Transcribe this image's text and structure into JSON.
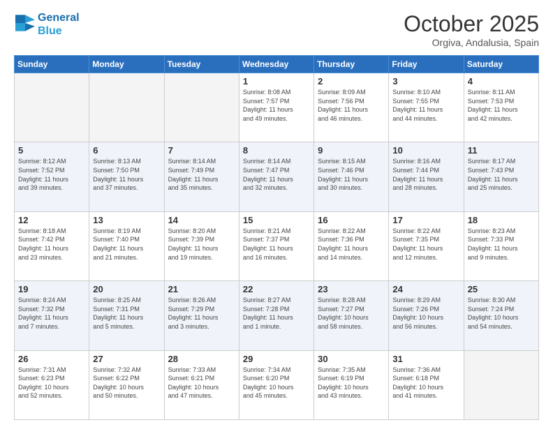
{
  "header": {
    "logo_line1": "General",
    "logo_line2": "Blue",
    "month": "October 2025",
    "location": "Orgiva, Andalusia, Spain"
  },
  "weekdays": [
    "Sunday",
    "Monday",
    "Tuesday",
    "Wednesday",
    "Thursday",
    "Friday",
    "Saturday"
  ],
  "weeks": [
    [
      {
        "day": "",
        "info": ""
      },
      {
        "day": "",
        "info": ""
      },
      {
        "day": "",
        "info": ""
      },
      {
        "day": "1",
        "info": "Sunrise: 8:08 AM\nSunset: 7:57 PM\nDaylight: 11 hours\nand 49 minutes."
      },
      {
        "day": "2",
        "info": "Sunrise: 8:09 AM\nSunset: 7:56 PM\nDaylight: 11 hours\nand 46 minutes."
      },
      {
        "day": "3",
        "info": "Sunrise: 8:10 AM\nSunset: 7:55 PM\nDaylight: 11 hours\nand 44 minutes."
      },
      {
        "day": "4",
        "info": "Sunrise: 8:11 AM\nSunset: 7:53 PM\nDaylight: 11 hours\nand 42 minutes."
      }
    ],
    [
      {
        "day": "5",
        "info": "Sunrise: 8:12 AM\nSunset: 7:52 PM\nDaylight: 11 hours\nand 39 minutes."
      },
      {
        "day": "6",
        "info": "Sunrise: 8:13 AM\nSunset: 7:50 PM\nDaylight: 11 hours\nand 37 minutes."
      },
      {
        "day": "7",
        "info": "Sunrise: 8:14 AM\nSunset: 7:49 PM\nDaylight: 11 hours\nand 35 minutes."
      },
      {
        "day": "8",
        "info": "Sunrise: 8:14 AM\nSunset: 7:47 PM\nDaylight: 11 hours\nand 32 minutes."
      },
      {
        "day": "9",
        "info": "Sunrise: 8:15 AM\nSunset: 7:46 PM\nDaylight: 11 hours\nand 30 minutes."
      },
      {
        "day": "10",
        "info": "Sunrise: 8:16 AM\nSunset: 7:44 PM\nDaylight: 11 hours\nand 28 minutes."
      },
      {
        "day": "11",
        "info": "Sunrise: 8:17 AM\nSunset: 7:43 PM\nDaylight: 11 hours\nand 25 minutes."
      }
    ],
    [
      {
        "day": "12",
        "info": "Sunrise: 8:18 AM\nSunset: 7:42 PM\nDaylight: 11 hours\nand 23 minutes."
      },
      {
        "day": "13",
        "info": "Sunrise: 8:19 AM\nSunset: 7:40 PM\nDaylight: 11 hours\nand 21 minutes."
      },
      {
        "day": "14",
        "info": "Sunrise: 8:20 AM\nSunset: 7:39 PM\nDaylight: 11 hours\nand 19 minutes."
      },
      {
        "day": "15",
        "info": "Sunrise: 8:21 AM\nSunset: 7:37 PM\nDaylight: 11 hours\nand 16 minutes."
      },
      {
        "day": "16",
        "info": "Sunrise: 8:22 AM\nSunset: 7:36 PM\nDaylight: 11 hours\nand 14 minutes."
      },
      {
        "day": "17",
        "info": "Sunrise: 8:22 AM\nSunset: 7:35 PM\nDaylight: 11 hours\nand 12 minutes."
      },
      {
        "day": "18",
        "info": "Sunrise: 8:23 AM\nSunset: 7:33 PM\nDaylight: 11 hours\nand 9 minutes."
      }
    ],
    [
      {
        "day": "19",
        "info": "Sunrise: 8:24 AM\nSunset: 7:32 PM\nDaylight: 11 hours\nand 7 minutes."
      },
      {
        "day": "20",
        "info": "Sunrise: 8:25 AM\nSunset: 7:31 PM\nDaylight: 11 hours\nand 5 minutes."
      },
      {
        "day": "21",
        "info": "Sunrise: 8:26 AM\nSunset: 7:29 PM\nDaylight: 11 hours\nand 3 minutes."
      },
      {
        "day": "22",
        "info": "Sunrise: 8:27 AM\nSunset: 7:28 PM\nDaylight: 11 hours\nand 1 minute."
      },
      {
        "day": "23",
        "info": "Sunrise: 8:28 AM\nSunset: 7:27 PM\nDaylight: 10 hours\nand 58 minutes."
      },
      {
        "day": "24",
        "info": "Sunrise: 8:29 AM\nSunset: 7:26 PM\nDaylight: 10 hours\nand 56 minutes."
      },
      {
        "day": "25",
        "info": "Sunrise: 8:30 AM\nSunset: 7:24 PM\nDaylight: 10 hours\nand 54 minutes."
      }
    ],
    [
      {
        "day": "26",
        "info": "Sunrise: 7:31 AM\nSunset: 6:23 PM\nDaylight: 10 hours\nand 52 minutes."
      },
      {
        "day": "27",
        "info": "Sunrise: 7:32 AM\nSunset: 6:22 PM\nDaylight: 10 hours\nand 50 minutes."
      },
      {
        "day": "28",
        "info": "Sunrise: 7:33 AM\nSunset: 6:21 PM\nDaylight: 10 hours\nand 47 minutes."
      },
      {
        "day": "29",
        "info": "Sunrise: 7:34 AM\nSunset: 6:20 PM\nDaylight: 10 hours\nand 45 minutes."
      },
      {
        "day": "30",
        "info": "Sunrise: 7:35 AM\nSunset: 6:19 PM\nDaylight: 10 hours\nand 43 minutes."
      },
      {
        "day": "31",
        "info": "Sunrise: 7:36 AM\nSunset: 6:18 PM\nDaylight: 10 hours\nand 41 minutes."
      },
      {
        "day": "",
        "info": ""
      }
    ]
  ]
}
